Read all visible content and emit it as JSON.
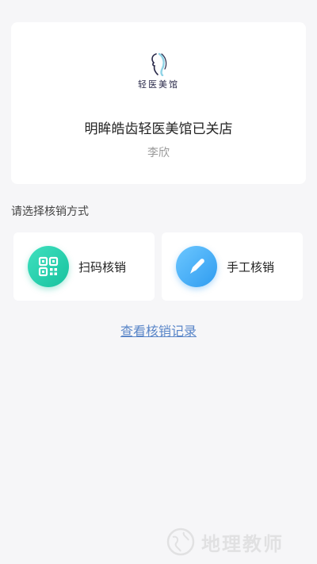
{
  "store": {
    "logo_text": "轻医美馆",
    "name": "明眸皓齿轻医美馆已关店",
    "operator": "李欣"
  },
  "section_label": "请选择核销方式",
  "methods": [
    {
      "label": "扫码核销",
      "icon": "qr-code-icon",
      "color": "#1ec8a4"
    },
    {
      "label": "手工核销",
      "icon": "pencil-icon",
      "color": "#3aa6f5"
    }
  ],
  "records_link": "查看核销记录",
  "watermark": "地理教师"
}
